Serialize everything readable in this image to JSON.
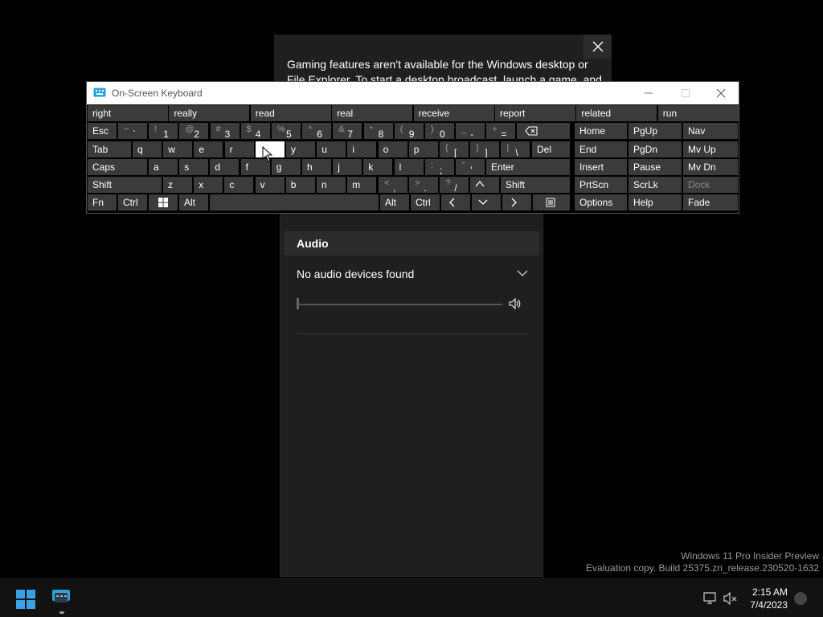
{
  "notification": {
    "text": "Gaming features aren't available for the Windows desktop or File Explorer. To start a desktop broadcast, launch a game, and"
  },
  "osk": {
    "title": "On-Screen Keyboard",
    "predictions": [
      "right",
      "really",
      "read",
      "real",
      "receive",
      "report",
      "related",
      "run"
    ],
    "row1": [
      {
        "label": "Esc"
      },
      {
        "shift": "~",
        "main": "`"
      },
      {
        "shift": "!",
        "main": "1"
      },
      {
        "shift": "@",
        "main": "2"
      },
      {
        "shift": "#",
        "main": "3"
      },
      {
        "shift": "$",
        "main": "4"
      },
      {
        "shift": "%",
        "main": "5"
      },
      {
        "shift": "^",
        "main": "6"
      },
      {
        "shift": "&",
        "main": "7"
      },
      {
        "shift": "*",
        "main": "8"
      },
      {
        "shift": "(",
        "main": "9"
      },
      {
        "shift": ")",
        "main": "0"
      },
      {
        "shift": "_",
        "main": "-"
      },
      {
        "shift": "+",
        "main": "="
      }
    ],
    "row2": [
      "Tab",
      "q",
      "w",
      "e",
      "r",
      "t",
      "y",
      "u",
      "i",
      "o",
      "p"
    ],
    "row2b": [
      {
        "shift": "{",
        "main": "["
      },
      {
        "shift": "}",
        "main": "]"
      },
      {
        "shift": "|",
        "main": "\\"
      }
    ],
    "del": "Del",
    "row3": [
      "Caps",
      "a",
      "s",
      "d",
      "f",
      "g",
      "h",
      "j",
      "k",
      "l"
    ],
    "row3b": [
      {
        "shift": ":",
        "main": ";"
      },
      {
        "shift": "\"",
        "main": "'"
      }
    ],
    "enter": "Enter",
    "row4": [
      "Shift",
      "z",
      "x",
      "c",
      "v",
      "b",
      "n",
      "m"
    ],
    "row4b": [
      {
        "shift": "<",
        "main": ","
      },
      {
        "shift": ">",
        "main": "."
      },
      {
        "shift": "?",
        "main": "/"
      }
    ],
    "shift_r": "Shift",
    "row5": {
      "fn": "Fn",
      "ctrl": "Ctrl",
      "alt": "Alt",
      "alt_r": "Alt",
      "ctrl_r": "Ctrl"
    },
    "nav": [
      [
        "Home",
        "PgUp",
        "Nav"
      ],
      [
        "End",
        "PgDn",
        "Mv Up"
      ],
      [
        "Insert",
        "Pause",
        "Mv Dn"
      ],
      [
        "PrtScn",
        "ScrLk",
        "Dock"
      ],
      [
        "Options",
        "Help",
        "Fade"
      ]
    ]
  },
  "gamebar": {
    "audio_header": "Audio",
    "device": "No audio devices found",
    "volume": 0
  },
  "watermark": {
    "line1": "Windows 11 Pro Insider Preview",
    "line2": "Evaluation copy. Build 25375.zn_release.230520-1632"
  },
  "taskbar": {
    "time": "2:15 AM",
    "date": "7/4/2023"
  }
}
